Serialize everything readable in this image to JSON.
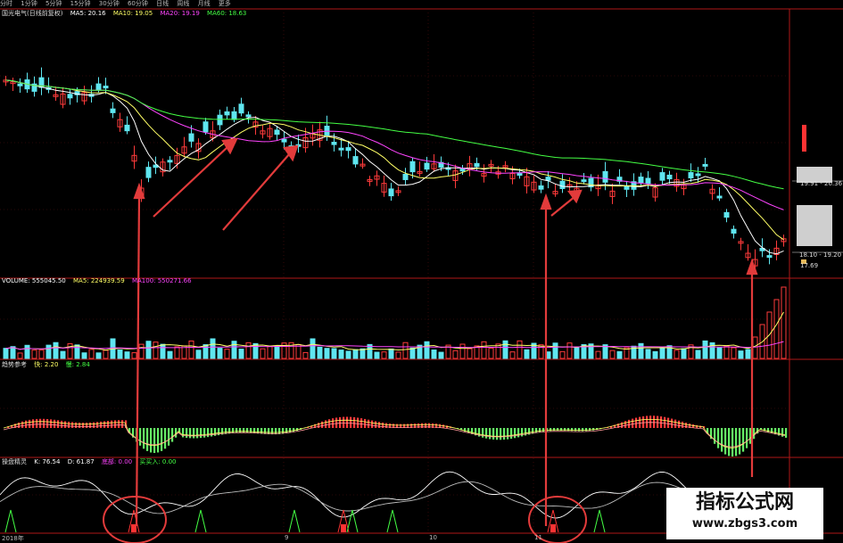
{
  "toolbar": {
    "items": [
      "分时",
      "1分钟",
      "5分钟",
      "15分钟",
      "30分钟",
      "60分钟",
      "日线",
      "周线",
      "月线",
      "更多"
    ]
  },
  "main_panel": {
    "title": "国光电气(日线前复权)",
    "ma": [
      {
        "label": "MA5: 20.16",
        "color": "#ffffff"
      },
      {
        "label": "MA10: 19.05",
        "color": "#ffff66"
      },
      {
        "label": "MA20: 19.19",
        "color": "#ff44ff"
      },
      {
        "label": "MA60: 18.63",
        "color": "#44ff44"
      }
    ],
    "price_high_label": "19.91 - 20.36",
    "price_low_label": "18.10 - 19.20",
    "price_min_label": "17.69"
  },
  "volume_panel": {
    "legend": [
      {
        "label": "VOLUME: 555045.50",
        "color": "#ffffff"
      },
      {
        "label": "MA5: 224939.59",
        "color": "#ffff66"
      },
      {
        "label": "MA100: 550271.66",
        "color": "#ff44ff"
      }
    ]
  },
  "macd_panel": {
    "title": "趋势参考",
    "legend": [
      {
        "label": "快: 2.20",
        "color": "#ffff66"
      },
      {
        "label": "慢: 2.84",
        "color": "#44ff44"
      }
    ]
  },
  "kd_panel": {
    "title": "操盘精灵",
    "legend": [
      {
        "label": "K: 76.54",
        "color": "#ffffff"
      },
      {
        "label": "D: 61.87",
        "color": "#ffffff"
      },
      {
        "label": "底部: 0.00",
        "color": "#ff44ff"
      },
      {
        "label": "买买入: 0.00",
        "color": "#44ff44"
      }
    ]
  },
  "axis": {
    "dates": [
      "2018年",
      "9",
      "10",
      "11"
    ]
  },
  "watermark": {
    "title": "指标公式网",
    "url": "www.zbgs3.com"
  }
}
